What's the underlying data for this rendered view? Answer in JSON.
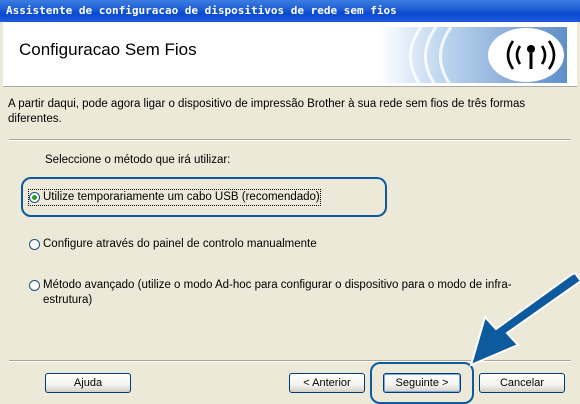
{
  "window": {
    "title": "Assistente de configuracao de dispositivos de rede sem fios"
  },
  "header": {
    "title": "Configuracao Sem Fios",
    "logo_icon": "wireless-signal-icon"
  },
  "content": {
    "intro": "A partir daqui, pode agora ligar o dispositivo de impressão Brother à sua rede sem fios de três formas diferentes.",
    "prompt": "Seleccione o método que irá utilizar:",
    "options": [
      {
        "label": "Utilize temporariamente um cabo USB (recomendado)",
        "selected": true
      },
      {
        "label": "Configure através do painel de controlo manualmente",
        "selected": false
      },
      {
        "label": "Método avançado (utilize o modo Ad-hoc para configurar o dispositivo para o modo de infra-estrutura)",
        "selected": false
      }
    ]
  },
  "buttons": {
    "help": "Ajuda",
    "back": "< Anterior",
    "next": "Seguinte >",
    "cancel": "Cancelar"
  },
  "annotations": {
    "pointer_icon": "big-arrow-icon",
    "color": "#0d5a9e"
  }
}
